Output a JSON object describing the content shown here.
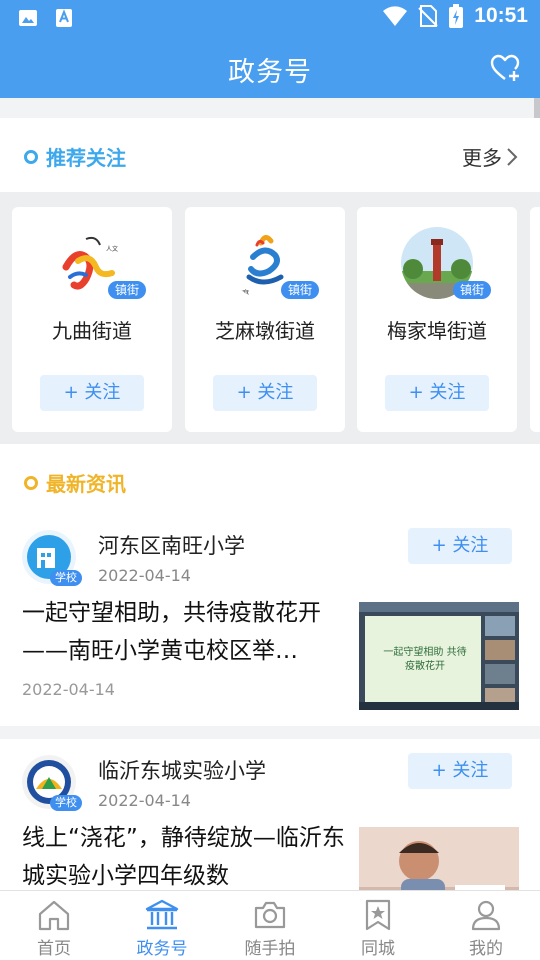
{
  "status_bar": {
    "time": "10:51"
  },
  "app_bar": {
    "title": "政务号"
  },
  "recommend": {
    "title": "推荐关注",
    "more_label": "更多",
    "cards": [
      {
        "name": "九曲街道",
        "tag": "镇街",
        "follow_label": "+ 关注"
      },
      {
        "name": "芝麻墩街道",
        "tag": "镇街",
        "follow_label": "+ 关注"
      },
      {
        "name": "梅家埠街道",
        "tag": "镇街",
        "follow_label": "+ 关注"
      }
    ]
  },
  "latest": {
    "title": "最新资讯",
    "items": [
      {
        "source": "河东区南旺小学",
        "source_tag": "学校",
        "source_date": "2022-04-14",
        "follow_label": "+ 关注",
        "headline": "一起守望相助，共待疫散花开 ——南旺小学黄屯校区举…",
        "post_date": "2022-04-14",
        "thumb_text": "一起守望相助 共待疫散花开"
      },
      {
        "source": "临沂东城实验小学",
        "source_tag": "学校",
        "source_date": "2022-04-14",
        "follow_label": "+ 关注",
        "headline": "线上“浇花”，静待绽放—临沂东城实验小学四年级数",
        "post_date": "",
        "thumb_text": ""
      }
    ]
  },
  "tabs": [
    {
      "label": "首页",
      "icon": "home-icon",
      "active": false
    },
    {
      "label": "政务号",
      "icon": "government-icon",
      "active": true
    },
    {
      "label": "随手拍",
      "icon": "camera-icon",
      "active": false
    },
    {
      "label": "同城",
      "icon": "star-bookmark-icon",
      "active": false
    },
    {
      "label": "我的",
      "icon": "user-icon",
      "active": false
    }
  ],
  "colors": {
    "primary": "#4a9ef0",
    "accent_blue": "#3e8ff0",
    "recommend_title": "#3ea8ec",
    "latest_title": "#f0b429"
  }
}
